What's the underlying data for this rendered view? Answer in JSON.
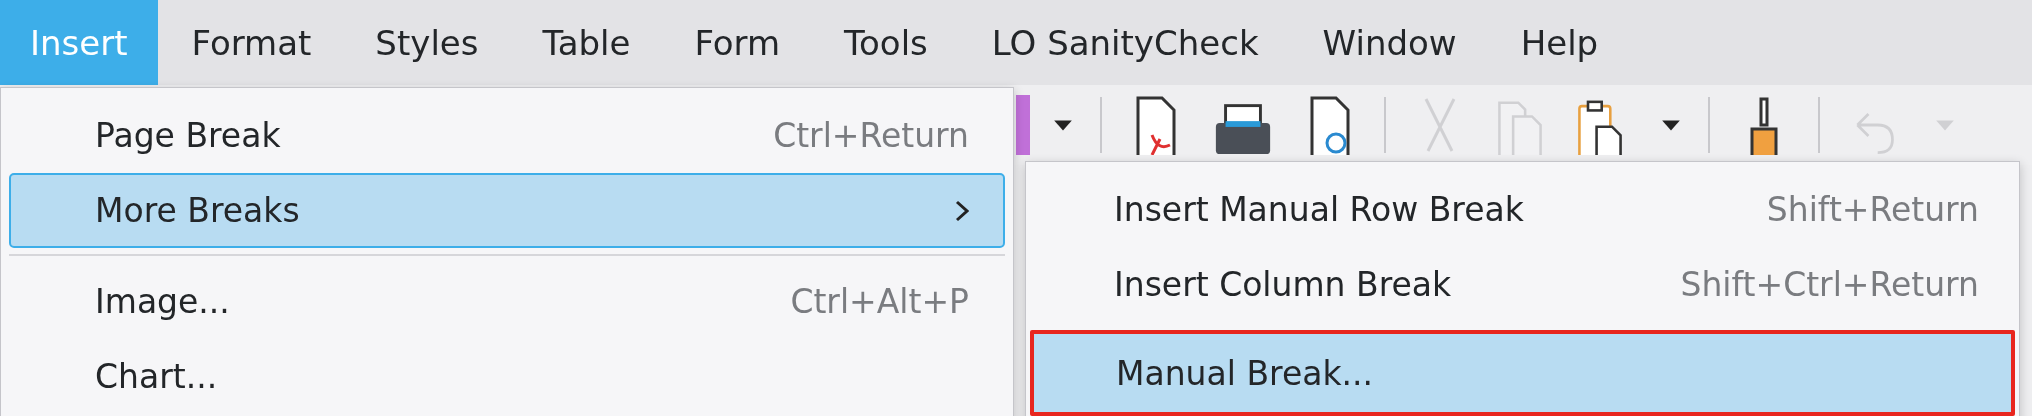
{
  "menubar": [
    {
      "label": "Insert",
      "selected": true
    },
    {
      "label": "Format",
      "selected": false
    },
    {
      "label": "Styles",
      "selected": false
    },
    {
      "label": "Table",
      "selected": false
    },
    {
      "label": "Form",
      "selected": false
    },
    {
      "label": "Tools",
      "selected": false
    },
    {
      "label": "LO SanityCheck",
      "selected": false
    },
    {
      "label": "Window",
      "selected": false
    },
    {
      "label": "Help",
      "selected": false
    }
  ],
  "toolbar": [
    {
      "kind": "dropdown",
      "disabled": false
    },
    {
      "kind": "separator"
    },
    {
      "kind": "pdf",
      "disabled": false
    },
    {
      "kind": "print",
      "disabled": false
    },
    {
      "kind": "preview",
      "disabled": false
    },
    {
      "kind": "separator"
    },
    {
      "kind": "cut",
      "disabled": true
    },
    {
      "kind": "copy",
      "disabled": true
    },
    {
      "kind": "paste",
      "disabled": false
    },
    {
      "kind": "dropdown",
      "disabled": false
    },
    {
      "kind": "separator"
    },
    {
      "kind": "brush",
      "disabled": false
    },
    {
      "kind": "separator"
    },
    {
      "kind": "undo",
      "disabled": true
    },
    {
      "kind": "dropdown",
      "disabled": true
    }
  ],
  "insert_menu": [
    {
      "kind": "item",
      "label": "Page Break",
      "shortcut": "Ctrl+Return",
      "selected": false,
      "submenu": false
    },
    {
      "kind": "item",
      "label": "More Breaks",
      "selected": true,
      "submenu": true
    },
    {
      "kind": "separator"
    },
    {
      "kind": "item",
      "label": "Image...",
      "shortcut": "Ctrl+Alt+P",
      "selected": false,
      "submenu": false
    },
    {
      "kind": "item",
      "label": "Chart...",
      "selected": false,
      "submenu": false
    }
  ],
  "breaks_submenu": [
    {
      "label": "Insert Manual Row Break",
      "shortcut": "Shift+Return",
      "selected": false,
      "outlined": false
    },
    {
      "label": "Insert Column Break",
      "shortcut": "Shift+Ctrl+Return",
      "selected": false,
      "outlined": false
    },
    {
      "label": "Manual Break...",
      "selected": true,
      "outlined": true
    }
  ]
}
